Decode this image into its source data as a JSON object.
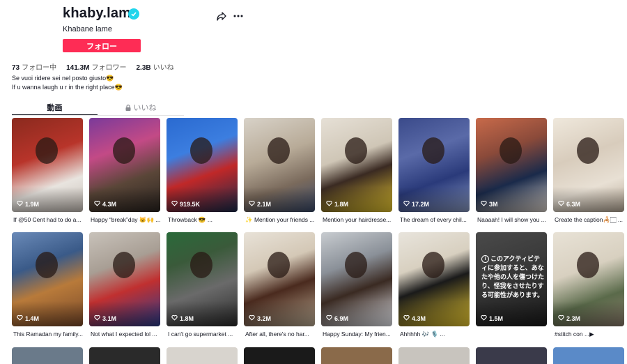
{
  "profile": {
    "username": "khaby.lame",
    "nickname": "Khabane lame",
    "follow_label": "フォロー",
    "verified": true
  },
  "stats": {
    "following_count": "73",
    "following_label": "フォロー中",
    "followers_count": "141.3M",
    "followers_label": "フォロワー",
    "likes_count": "2.3B",
    "likes_label": "いいね"
  },
  "bio": {
    "line1": "Se vuoi ridere sei nel posto giusto😎",
    "line2": "If u wanna laugh u r in the right place😎"
  },
  "tabs": {
    "videos": "動画",
    "liked": "いいね"
  },
  "icons": {
    "verified": "verified-badge-icon",
    "share": "share-icon",
    "more": "more-icon",
    "lock": "lock-icon",
    "heart": "heart-outline-icon"
  },
  "colors": {
    "accent": "#fe2c55",
    "verified": "#20d5ec",
    "text": "#161823",
    "muted": "#8a8b91"
  },
  "videos": [
    {
      "views": "1.9M",
      "caption": "If @50 Cent had to do a..."
    },
    {
      "views": "4.3M",
      "caption": "Happy “break”day 🐱🙌 ..."
    },
    {
      "views": "919.5K",
      "caption": "Throwback 😎 ..."
    },
    {
      "views": "2.1M",
      "caption": "✨ Mention your friends ..."
    },
    {
      "views": "1.8M",
      "caption": "Mention your hairdresse..."
    },
    {
      "views": "17.2M",
      "caption": "The dream of every chil..."
    },
    {
      "views": "3M",
      "caption": "Naaaah! I will show you ..."
    },
    {
      "views": "6.3M",
      "caption": "Create the caption🦂🏻 ..."
    },
    {
      "views": "1.4M",
      "caption": "This Ramadan my family..."
    },
    {
      "views": "3.1M",
      "caption": "Not what I expected lol ..."
    },
    {
      "views": "1.8M",
      "caption": "I can't go supermarket ..."
    },
    {
      "views": "3.2M",
      "caption": "After all, there's no har..."
    },
    {
      "views": "6.9M",
      "caption": "Happy Sunday: My frien..."
    },
    {
      "views": "4.3M",
      "caption": "Ahhhhh 🎶 🎙️ ..."
    },
    {
      "views": "1.5M",
      "caption": "",
      "overlay": "このアクティビティに参加すると、あなたや他の人を傷つけたり、怪我をさせたりする可能性があります。"
    },
    {
      "views": "2.3M",
      "caption": "#stitch con ...▶"
    }
  ]
}
